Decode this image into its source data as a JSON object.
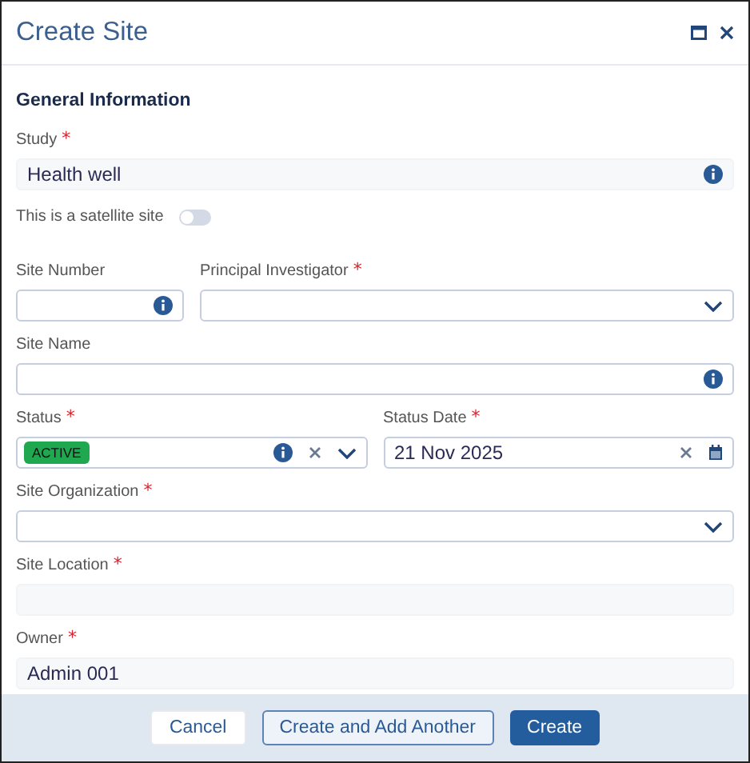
{
  "window": {
    "title": "Create Site"
  },
  "section": {
    "title": "General Information"
  },
  "rows": [
    {
      "kind": "single",
      "fields": [
        {
          "kind": "readonly",
          "label": "Study",
          "marker": "*",
          "value": "Health well",
          "info": true
        }
      ]
    },
    {
      "kind": "single",
      "fields": [
        {
          "kind": "toggle",
          "label": "This is a satellite site",
          "on": false
        }
      ]
    },
    {
      "kind": "split",
      "fields": [
        {
          "kind": "text",
          "label": "Site Number",
          "info": true
        },
        {
          "kind": "select",
          "label": "Principal Investigator",
          "marker": "*"
        }
      ]
    },
    {
      "kind": "single",
      "fields": [
        {
          "kind": "text",
          "label": "Site Name",
          "info": true
        }
      ]
    },
    {
      "kind": "halves",
      "fields": [
        {
          "kind": "chip-select",
          "label": "Status",
          "marker": "*",
          "chip": "ACTIVE",
          "color": "#1fa84f",
          "info": true,
          "clear": true
        },
        {
          "kind": "date",
          "label": "Status Date",
          "marker": "*",
          "value": "21 Nov 2025",
          "clear": true
        }
      ]
    },
    {
      "kind": "single",
      "fields": [
        {
          "kind": "select",
          "label": "Site Organization",
          "marker": "*"
        }
      ]
    },
    {
      "kind": "single",
      "fields": [
        {
          "kind": "readonly",
          "label": "Site Location",
          "marker": "*"
        }
      ]
    },
    {
      "kind": "single",
      "fields": [
        {
          "kind": "readonly",
          "label": "Owner",
          "marker": "*",
          "value": "Admin 001"
        }
      ]
    }
  ],
  "buttons": [
    {
      "label": "Cancel",
      "kind": "plain"
    },
    {
      "label": "Create and Add Another",
      "kind": "outline"
    },
    {
      "label": "Create",
      "kind": "primary"
    }
  ]
}
